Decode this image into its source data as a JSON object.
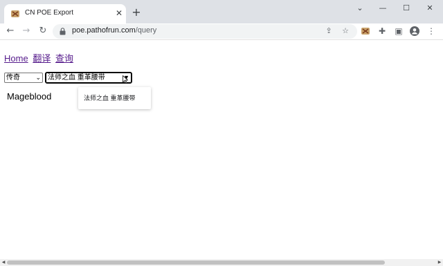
{
  "browser": {
    "tab": {
      "title": "CN POE Export",
      "favicon": "poe-favicon"
    },
    "new_tab_label": "+",
    "url_host": "poe.pathofrun.com",
    "url_path": "/query"
  },
  "nav": {
    "links": [
      "Home",
      "翻译",
      "查询"
    ]
  },
  "filters": {
    "rarity": "传奇",
    "item": "法师之血 重革腰带"
  },
  "result": {
    "name": "Mageblood"
  },
  "dropdown": {
    "options": [
      "法师之血 重革腰带"
    ]
  }
}
